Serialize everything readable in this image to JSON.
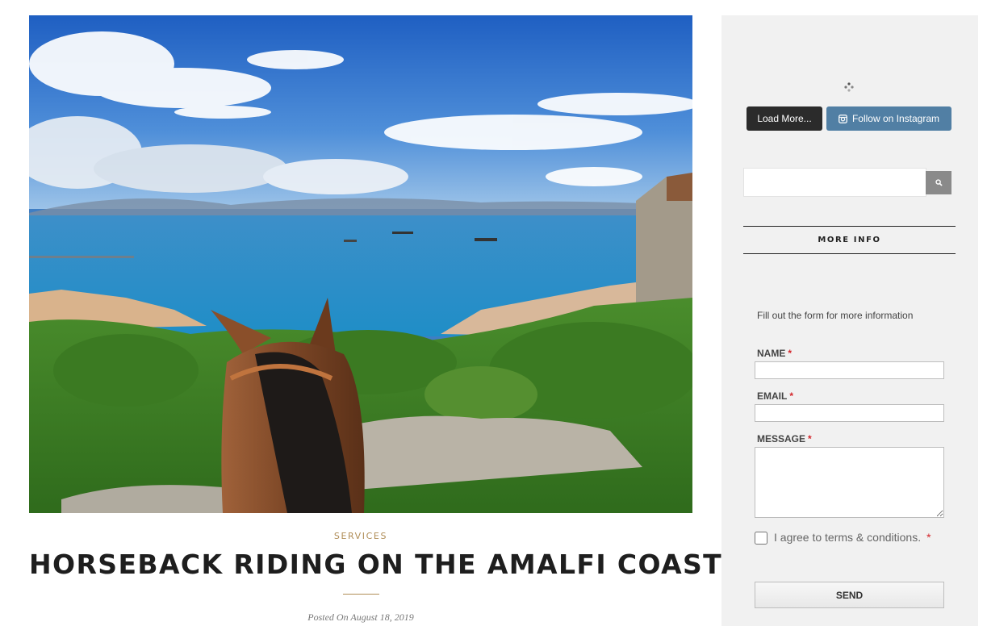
{
  "post": {
    "category": "SERVICES",
    "title": "HORSEBACK RIDING ON THE AMALFI COAST",
    "date": "Posted On August 18, 2019"
  },
  "sidebar": {
    "instagram": {
      "load_more_label": "Load More...",
      "follow_label": "Follow on Instagram"
    },
    "search": {
      "placeholder": "",
      "icon": "search-icon"
    },
    "widget_title": "MORE INFO",
    "form": {
      "intro": "Fill out the form for more information",
      "name_label": "NAME",
      "email_label": "EMAIL",
      "message_label": "MESSAGE",
      "required_mark": "*",
      "agree_label": "I agree to terms & conditions.",
      "send_label": "SEND",
      "name_value": "",
      "email_value": "",
      "message_value": "",
      "agree_checked": false
    }
  },
  "colors": {
    "accent_gold": "#b08d57",
    "instagram_blue": "#517fa4",
    "required_red": "#d4262b",
    "sidebar_bg": "#f1f1f1"
  }
}
